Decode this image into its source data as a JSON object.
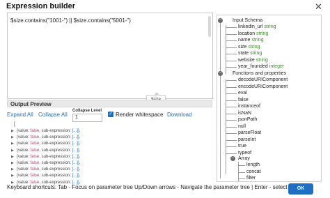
{
  "dialog": {
    "title": "Expression builder",
    "close_icon": "close-icon"
  },
  "editor": {
    "expression": "$size.contains(\"1001-\") || $size.contains(\"5001-\")"
  },
  "tooltip": {
    "text": "$size"
  },
  "preview": {
    "header": "Output Preview",
    "expand_all": "Expand All",
    "collapse_all": "Collapse All",
    "collapse_level_label": "Collapse Level",
    "collapse_level_value": "1",
    "render_whitespace_label": "Render whitespace",
    "render_whitespace_checked": true,
    "download": "Download",
    "bracket": "[",
    "rows": [
      {
        "key": "{value:",
        "value": "false,",
        "sub": "sub-expression:",
        "rest": "[...]},"
      },
      {
        "key": "{value:",
        "value": "false,",
        "sub": "sub-expression:",
        "rest": "[...]},"
      },
      {
        "key": "{value:",
        "value": "false,",
        "sub": "sub-expression:",
        "rest": "[...]},"
      },
      {
        "key": "{value:",
        "value": "false,",
        "sub": "sub-expression:",
        "rest": "[...]},"
      },
      {
        "key": "{value:",
        "value": "false,",
        "sub": "sub-expression:",
        "rest": "[...]},"
      },
      {
        "key": "{value:",
        "value": "false,",
        "sub": "sub-expression:",
        "rest": "[...]},"
      },
      {
        "key": "{value:",
        "value": "false,",
        "sub": "sub-expression:",
        "rest": "[...]},"
      },
      {
        "key": "{value:",
        "value": "false,",
        "sub": "sub-expression:",
        "rest": "[...]},"
      },
      {
        "key": "{value:",
        "value": "false,",
        "sub": "sub-expression:",
        "rest": "[...]},"
      }
    ]
  },
  "tree": {
    "input_schema": {
      "label": "Input Schema",
      "fields": [
        {
          "name": "linkedin_url",
          "type": "string"
        },
        {
          "name": "location",
          "type": "string"
        },
        {
          "name": "name",
          "type": "string"
        },
        {
          "name": "size",
          "type": "string"
        },
        {
          "name": "state",
          "type": "string"
        },
        {
          "name": "website",
          "type": "string"
        },
        {
          "name": "year_founded",
          "type": "integer"
        }
      ]
    },
    "functions": {
      "label": "Functions and properties",
      "items": [
        "decodeURIComponent",
        "encodeURIComponent",
        "eval",
        "false",
        "instanceof",
        "isNaN",
        "jsonPath",
        "null",
        "parseFloat",
        "parseInt",
        "true",
        "typeof"
      ]
    },
    "array": {
      "label": "Array",
      "items": [
        "length",
        "concat",
        "filter"
      ]
    }
  },
  "footer": {
    "shortcuts": "Keyboard shortcuts: Tab - Focus on parameter tree Up/Down arrows - Navigate the parameter tree | Enter - select a value",
    "ok": "OK"
  }
}
